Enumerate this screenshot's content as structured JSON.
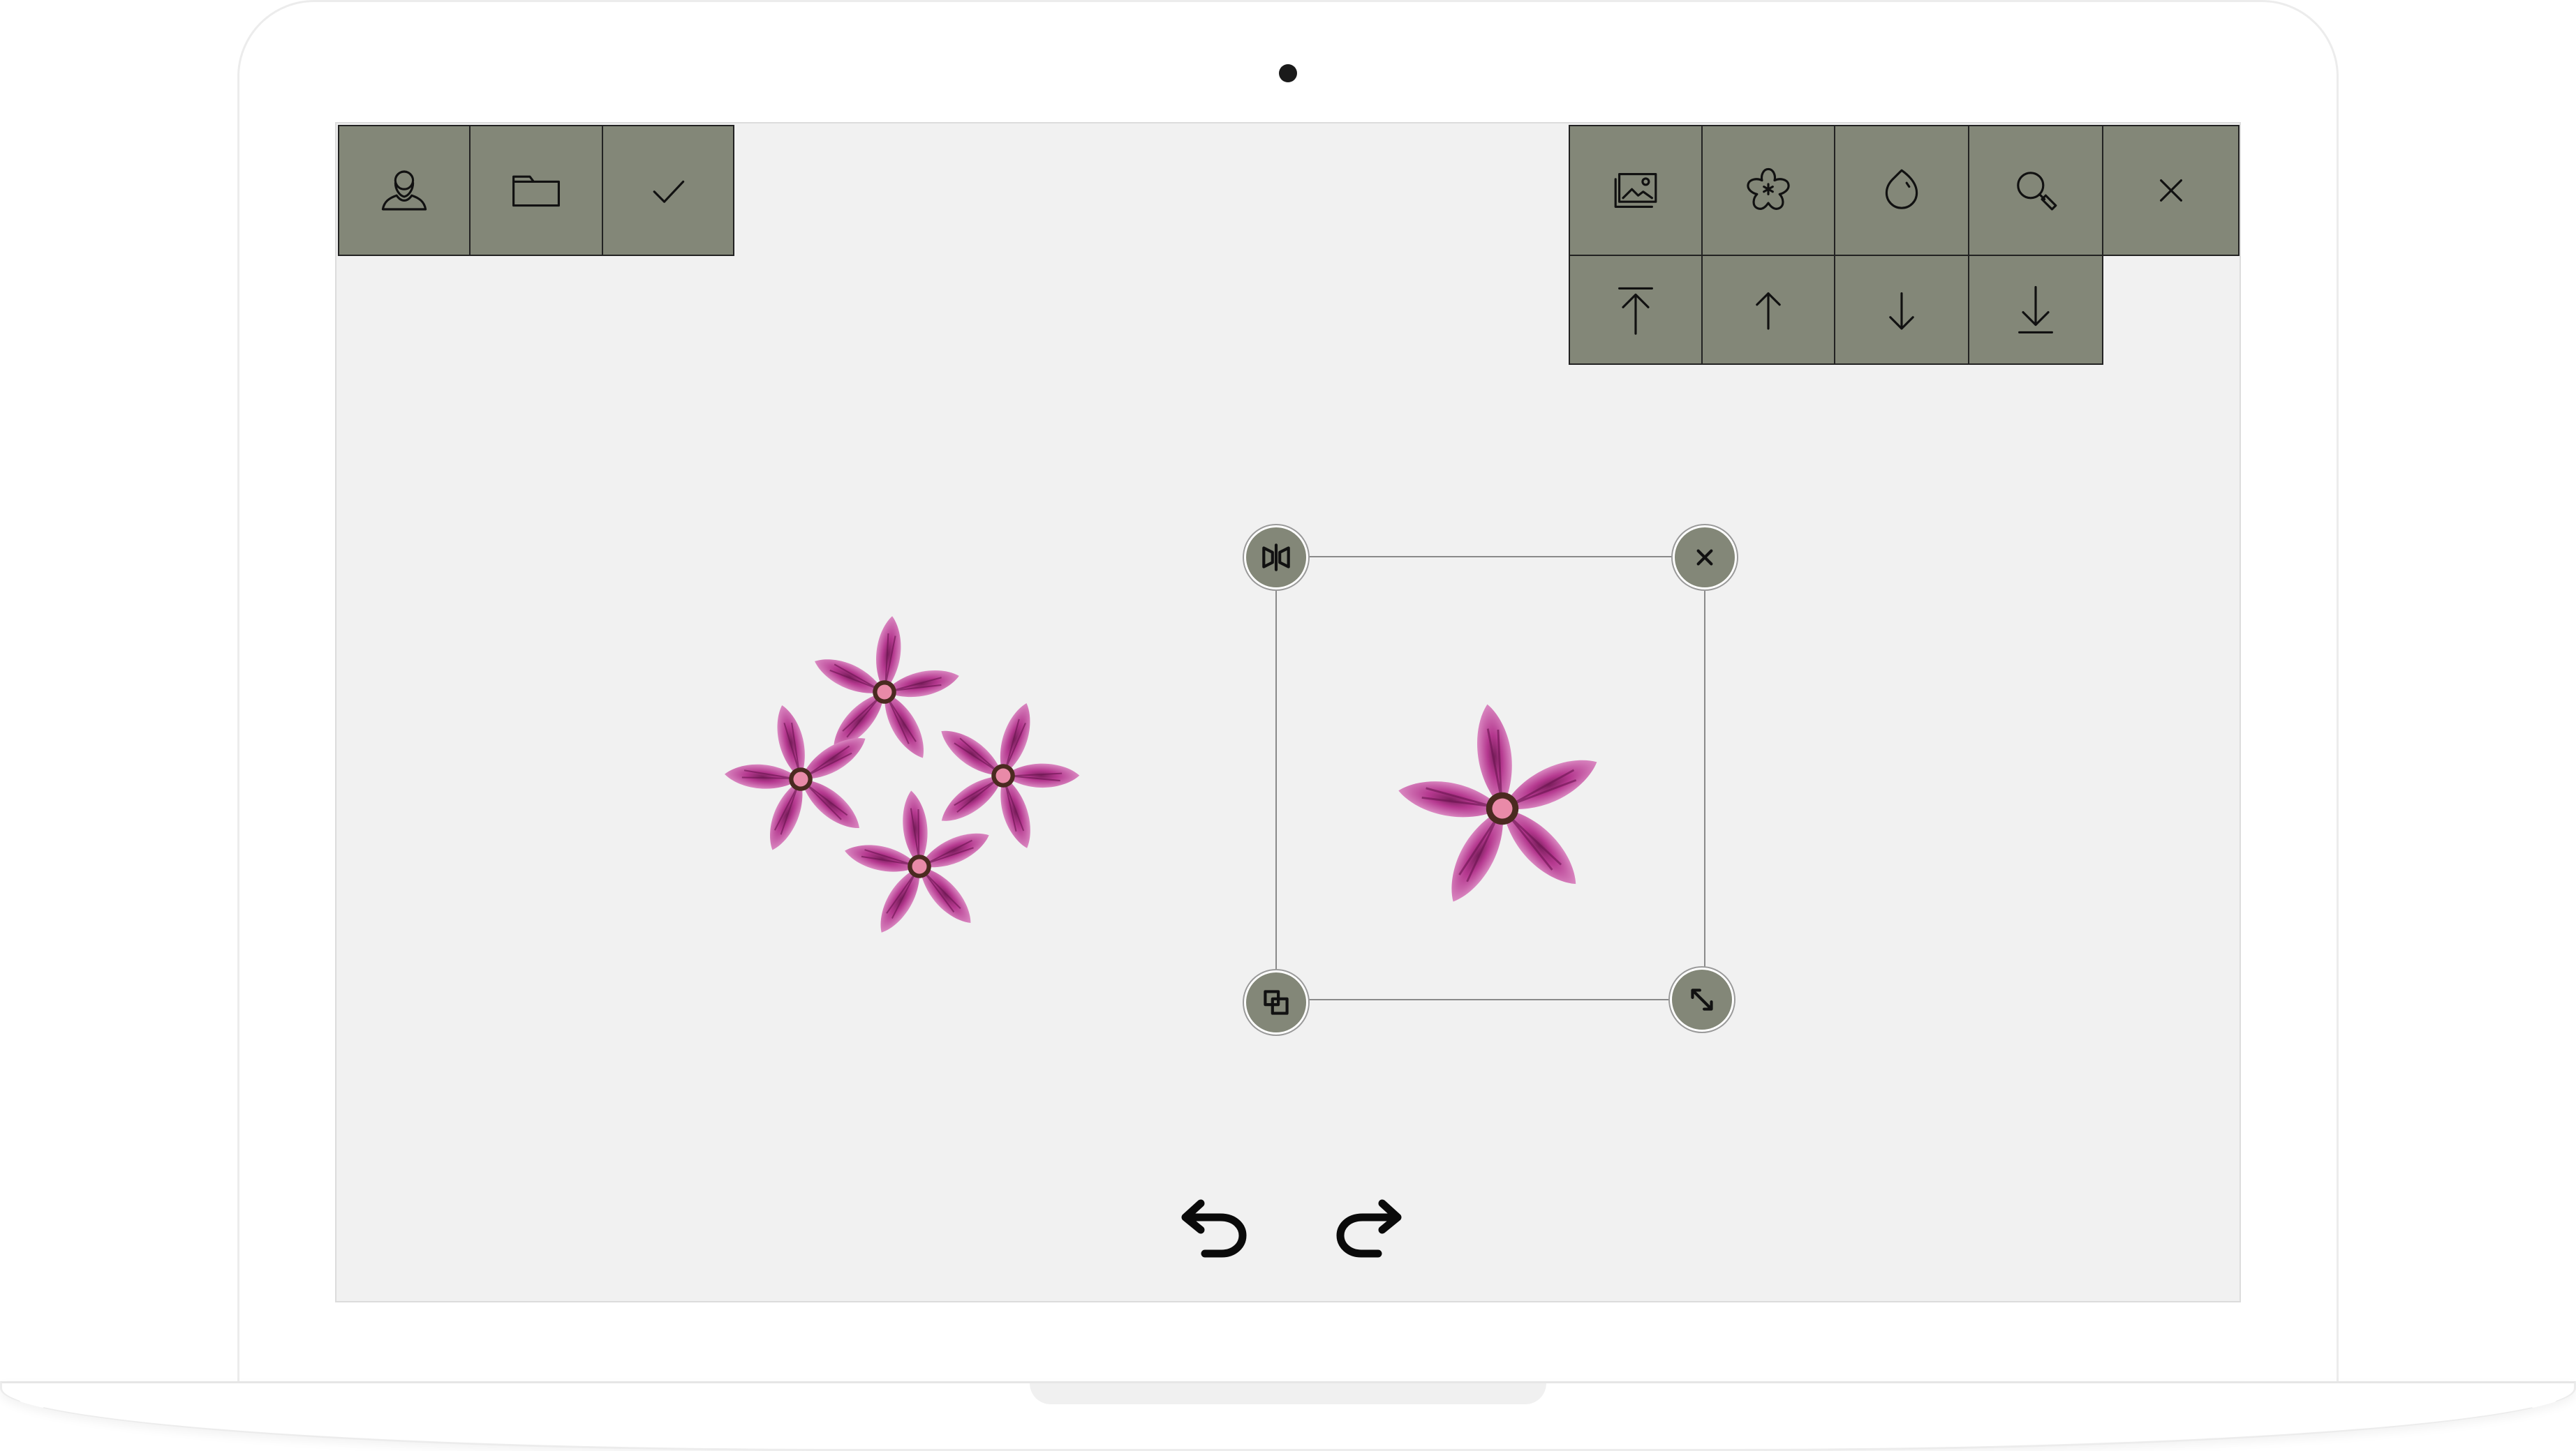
{
  "device": {
    "type": "laptop-mockup"
  },
  "toolbar_left": {
    "buttons": [
      {
        "name": "user-profile-button",
        "icon": "user-icon"
      },
      {
        "name": "open-folder-button",
        "icon": "folder-icon"
      },
      {
        "name": "confirm-button",
        "icon": "checkmark-icon"
      }
    ]
  },
  "toolbar_right": {
    "row1": [
      {
        "name": "background-image-button",
        "icon": "image-icon"
      },
      {
        "name": "stickers-button",
        "icon": "flower-star-icon"
      },
      {
        "name": "color-drop-button",
        "icon": "drop-icon"
      },
      {
        "name": "zoom-button",
        "icon": "magnifier-icon"
      },
      {
        "name": "close-button",
        "icon": "close-icon"
      }
    ],
    "row2": [
      {
        "name": "bring-to-front-button",
        "icon": "arrow-up-to-top-icon"
      },
      {
        "name": "bring-forward-button",
        "icon": "arrow-up-icon"
      },
      {
        "name": "send-backward-button",
        "icon": "arrow-down-icon"
      },
      {
        "name": "send-to-back-button",
        "icon": "arrow-down-to-bottom-icon"
      }
    ]
  },
  "canvas": {
    "items": [
      {
        "name": "flower-cluster",
        "count": 4,
        "color": "#b5388f"
      },
      {
        "name": "selected-flower",
        "count": 1,
        "color": "#b5388f",
        "selected": true
      }
    ]
  },
  "selection_handles": {
    "top_left": "flip-icon",
    "top_right": "delete-icon",
    "bottom_left": "duplicate-icon",
    "bottom_right": "resize-icon"
  },
  "history": {
    "undo_icon": "undo-icon",
    "redo_icon": "redo-icon"
  },
  "colors": {
    "toolbar": "#838778",
    "canvas": "#f1f1f1",
    "petal": "#b5388f",
    "petal_light": "#e7a5d3"
  }
}
